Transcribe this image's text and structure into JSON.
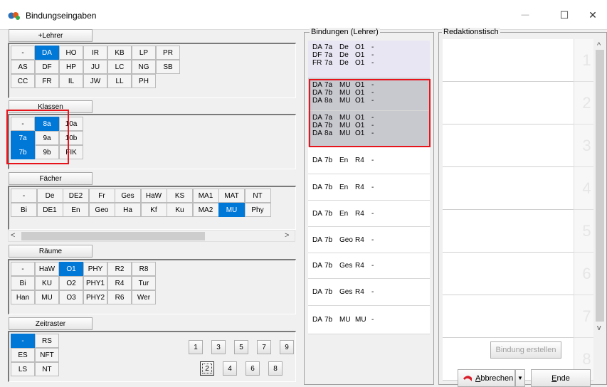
{
  "window": {
    "title": "Bindungseingaben",
    "minimize": "—",
    "maximize": "☐",
    "close": "✕"
  },
  "lehrer": {
    "header": "+Lehrer",
    "row1": [
      "-",
      "DA",
      "HO",
      "IR",
      "KB",
      "LP",
      "PR"
    ],
    "row2": [
      "AS",
      "DF",
      "HP",
      "JU",
      "LC",
      "NG",
      "SB"
    ],
    "row3": [
      "CC",
      "FR",
      "IL",
      "JW",
      "LL",
      "PH"
    ]
  },
  "klassen": {
    "header": "Klassen",
    "row1": [
      "-",
      "8a",
      "10a"
    ],
    "row2": [
      "7a",
      "9a",
      "10b"
    ],
    "row3": [
      "7b",
      "9b",
      "FIK"
    ]
  },
  "faecher": {
    "header": "Fächer",
    "row1": [
      "-",
      "De",
      "DE2",
      "Fr",
      "Ges",
      "HaW",
      "KS",
      "MA1",
      "MAT",
      "NT"
    ],
    "row2": [
      "Bi",
      "DE1",
      "En",
      "Geo",
      "Ha",
      "Kf",
      "Ku",
      "MA2",
      "MU",
      "Phy"
    ]
  },
  "raeume": {
    "header": "Räume",
    "row1": [
      "-",
      "HaW",
      "O1",
      "PHY",
      "R2",
      "R8"
    ],
    "row2": [
      "Bi",
      "KU",
      "O2",
      "PHY1",
      "R4",
      "Tur"
    ],
    "row3": [
      "Han",
      "MU",
      "O3",
      "PHY2",
      "R6",
      "Wer"
    ]
  },
  "zeitraster": {
    "header": "Zeitraster",
    "row1": [
      "-",
      "RS"
    ],
    "row2": [
      "ES",
      "NFT"
    ],
    "row3": [
      "LS",
      "NT"
    ]
  },
  "numbers": {
    "top": [
      "1",
      "3",
      "5",
      "7",
      "9"
    ],
    "bottom": [
      "2",
      "4",
      "6",
      "8"
    ]
  },
  "scrollbar": {
    "left": "<",
    "right": ">"
  },
  "bindungen": {
    "title": "Bindungen (Lehrer)",
    "groups": [
      {
        "lines": [
          [
            "DA",
            "7a",
            "De",
            "O1",
            "-"
          ],
          [
            "DF",
            "7a",
            "De",
            "O1",
            "-"
          ],
          [
            "FR",
            "7a",
            "De",
            "O1",
            "-"
          ]
        ]
      },
      {
        "lines": [
          [
            "DA",
            "7a",
            "MU",
            "O1",
            "-"
          ],
          [
            "DA",
            "7b",
            "MU",
            "O1",
            "-"
          ],
          [
            "DA",
            "8a",
            "MU",
            "O1",
            "-"
          ]
        ]
      },
      {
        "lines": [
          [
            "DA",
            "7a",
            "MU",
            "O1",
            "-"
          ],
          [
            "DA",
            "7b",
            "MU",
            "O1",
            "-"
          ],
          [
            "DA",
            "8a",
            "MU",
            "O1",
            "-"
          ]
        ]
      },
      {
        "lines": [
          [
            "DA",
            "7b",
            "En",
            "R4",
            "-"
          ]
        ]
      },
      {
        "lines": [
          [
            "DA",
            "7b",
            "En",
            "R4",
            "-"
          ]
        ]
      },
      {
        "lines": [
          [
            "DA",
            "7b",
            "En",
            "R4",
            "-"
          ]
        ]
      },
      {
        "lines": [
          [
            "DA",
            "7b",
            "Geo",
            "R4",
            "-"
          ]
        ]
      },
      {
        "lines": [
          [
            "DA",
            "7b",
            "Ges",
            "R4",
            "-"
          ]
        ]
      },
      {
        "lines": [
          [
            "DA",
            "7b",
            "Ges",
            "R4",
            "-"
          ]
        ]
      },
      {
        "lines": [
          [
            "DA",
            "7b",
            "MU",
            "MU",
            "-"
          ]
        ]
      }
    ]
  },
  "redaktion": {
    "title": "Redaktionstisch",
    "slots": [
      "1",
      "2",
      "3",
      "4",
      "5",
      "6",
      "7",
      "8"
    ],
    "up": "^",
    "down": "v"
  },
  "buttons": {
    "bindung_erstellen": "Bindung erstellen",
    "abbrechen": "Abbrechen",
    "abbrechen_access": "A",
    "abbrechen_rest": "bbrechen",
    "ende": "Ende",
    "ende_access": "E",
    "ende_rest": "nde"
  },
  "colors": {
    "selected": "#0078d7",
    "highlight": "#e8141c",
    "group_lavender": "#e9e6f3",
    "group_gray": "#c8c8cf"
  }
}
